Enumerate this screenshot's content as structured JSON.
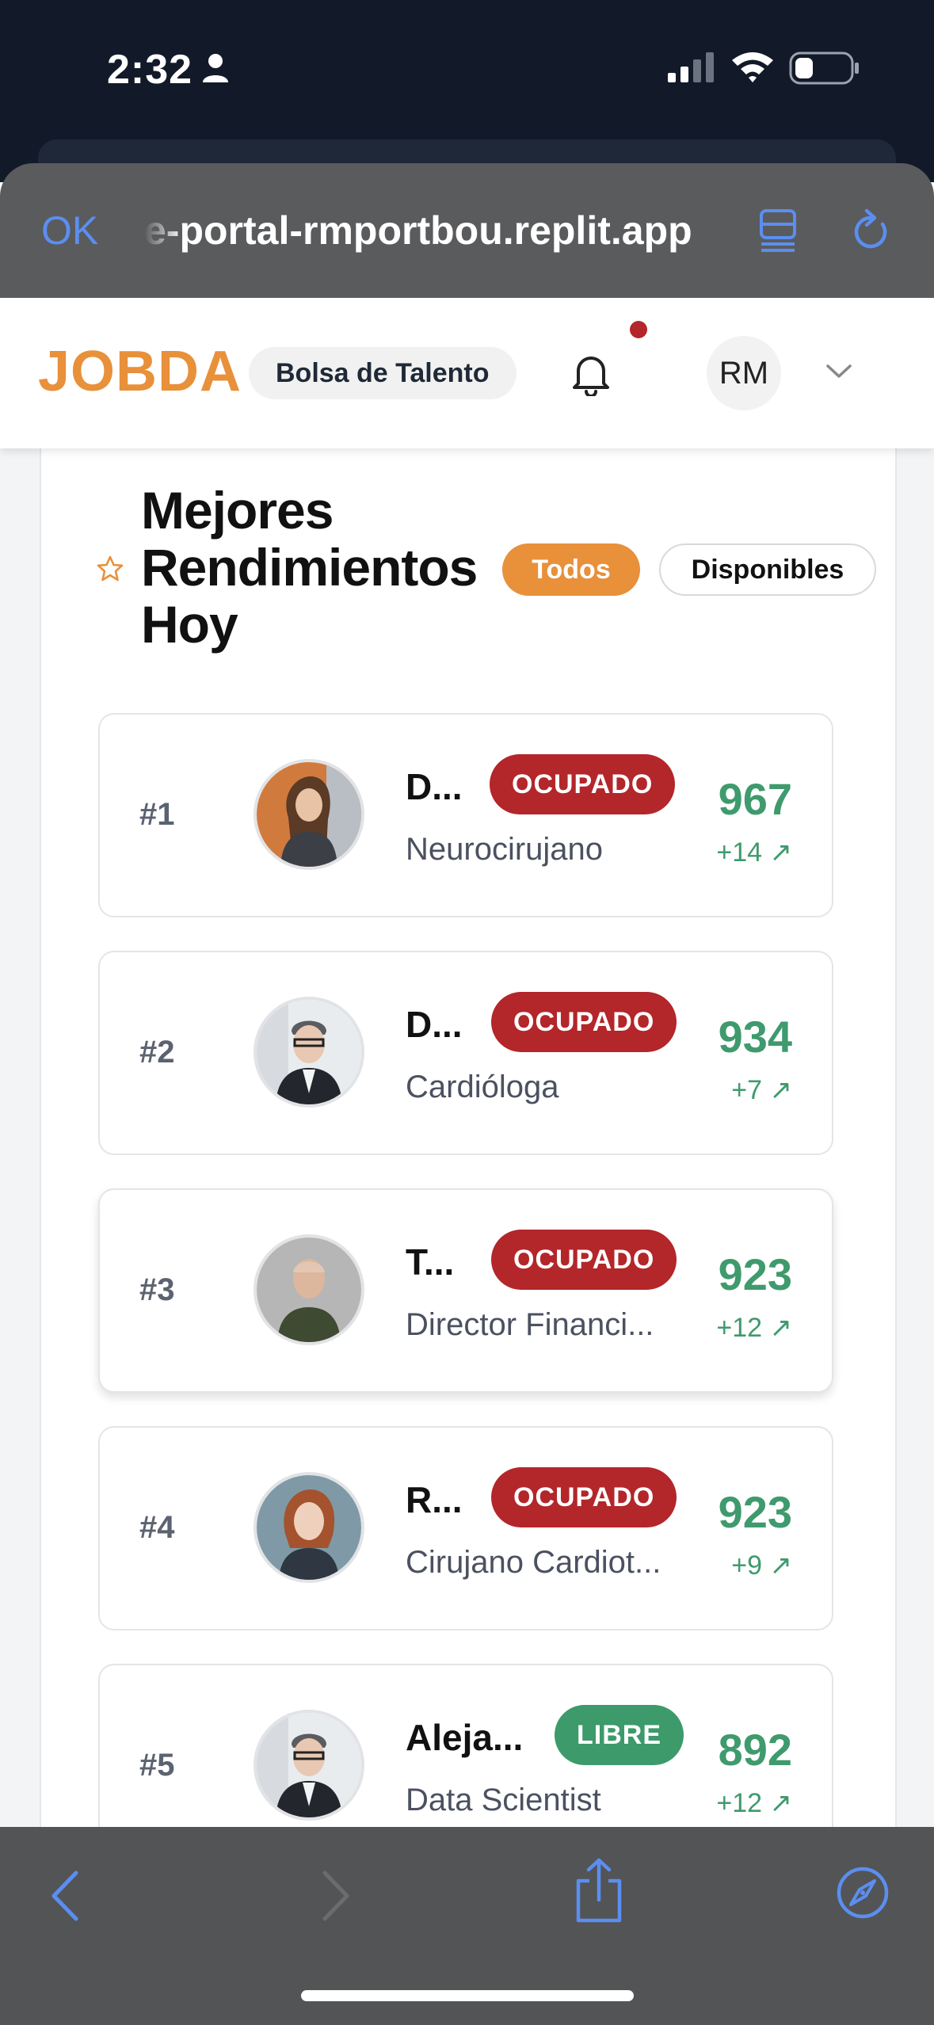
{
  "status_bar": {
    "time": "2:32"
  },
  "browser": {
    "done_label": "OK",
    "url": "e-portal-rmportbou.replit.app"
  },
  "header": {
    "logo": "JOBDA",
    "section_badge": "Bolsa de Talento",
    "user_initials": "RM"
  },
  "ranking": {
    "title_lines": [
      "Mejores",
      "Rendimientos",
      "Hoy"
    ],
    "filters": [
      "Todos",
      "Disponibles"
    ],
    "active_filter": "Todos",
    "candidates": [
      {
        "rank": "#1",
        "name": "D...",
        "status": "OCUPADO",
        "role": "Neurocirujano",
        "score": "967",
        "delta": "+14"
      },
      {
        "rank": "#2",
        "name": "D...",
        "status": "OCUPADO",
        "role": "Cardióloga",
        "score": "934",
        "delta": "+7"
      },
      {
        "rank": "#3",
        "name": "T...",
        "status": "OCUPADO",
        "role": "Director Financi...",
        "score": "923",
        "delta": "+12"
      },
      {
        "rank": "#4",
        "name": "R...",
        "status": "OCUPADO",
        "role": "Cirujano Cardiot...",
        "score": "923",
        "delta": "+9"
      },
      {
        "rank": "#5",
        "name": "Aleja...",
        "status": "LIBRE",
        "role": "Data Scientist",
        "score": "892",
        "delta": "+12"
      }
    ]
  },
  "colors": {
    "brand_orange": "#e8903a",
    "busy_red": "#b3262a",
    "free_green": "#3d9a6a",
    "score_green": "#3f9a6d",
    "link_blue": "#5b8ef0"
  }
}
